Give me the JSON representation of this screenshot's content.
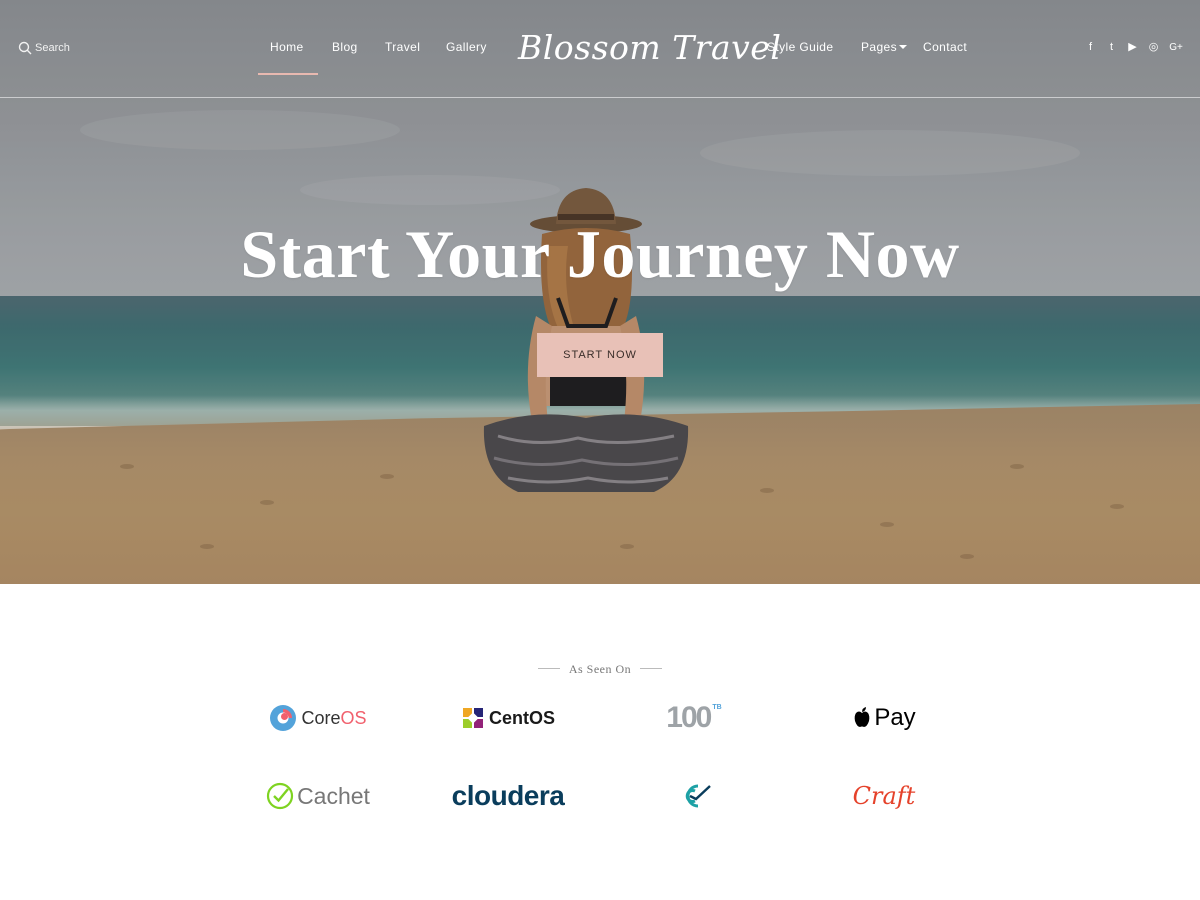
{
  "search": {
    "label": "Search"
  },
  "nav": {
    "items": [
      {
        "label": "Home"
      },
      {
        "label": "Blog"
      },
      {
        "label": "Travel"
      },
      {
        "label": "Gallery"
      },
      {
        "label": "Style Guide"
      },
      {
        "label": "Pages"
      },
      {
        "label": "Contact"
      }
    ],
    "active": "Home"
  },
  "logo": {
    "text": "Blossom Travel"
  },
  "social": {
    "icons": [
      "facebook-icon",
      "twitter-icon",
      "youtube-icon",
      "instagram-icon",
      "google-plus-icon"
    ],
    "glyphs": [
      "f",
      "t",
      "▶",
      "◎",
      "G+"
    ]
  },
  "hero": {
    "title": "Start Your Journey Now",
    "button_label": "START NOW"
  },
  "seen_on": {
    "heading": "As Seen On",
    "brands": [
      {
        "name": "CoreOS",
        "part1": "Core",
        "part2": "OS",
        "color": "#53a3da"
      },
      {
        "name": "CentOS",
        "text": "CentOS",
        "color": "#262577"
      },
      {
        "name": "100",
        "text": "100",
        "sup": "TB",
        "color": "#9ea3a7"
      },
      {
        "name": "Apple Pay",
        "text": "Pay",
        "color": "#000000"
      },
      {
        "name": "Cachet",
        "text": "Cachet",
        "color": "#7ed321"
      },
      {
        "name": "cloudera",
        "text": "cloudera",
        "color": "#0a3d5c"
      },
      {
        "name": "C-logo",
        "color": "#1da1a5"
      },
      {
        "name": "Craft",
        "text": "Craft",
        "color": "#e5422b"
      }
    ]
  },
  "colors": {
    "accent": "#e8c1b7",
    "nav_underline": "#e8b9b0"
  }
}
